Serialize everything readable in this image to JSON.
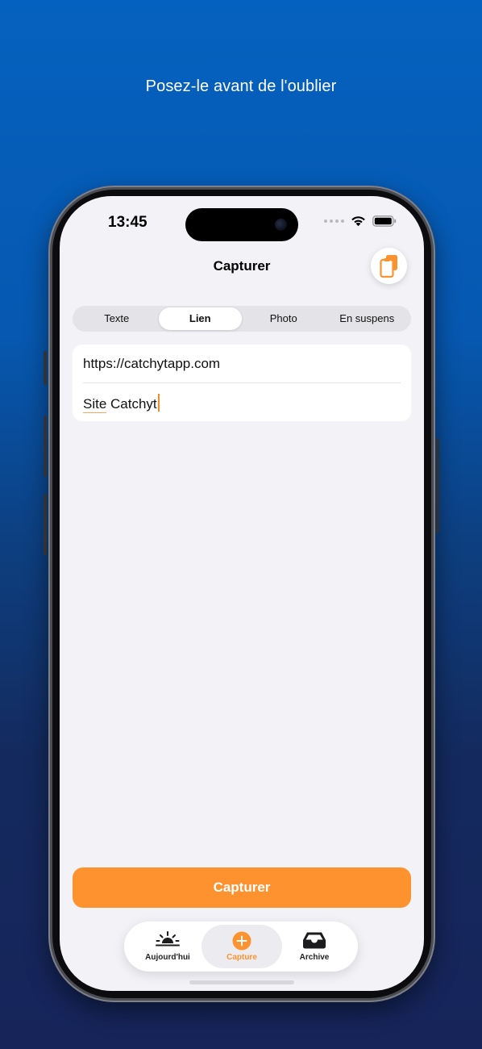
{
  "tagline": "Posez-le avant de l'oublier",
  "status_bar": {
    "time": "13:45"
  },
  "nav": {
    "title": "Capturer",
    "paste_icon": "clipboard-icon"
  },
  "segments": [
    {
      "label": "Texte",
      "active": false
    },
    {
      "label": "Lien",
      "active": true
    },
    {
      "label": "Photo",
      "active": false
    },
    {
      "label": "En suspens",
      "active": false
    }
  ],
  "form": {
    "url_value": "https://catchytapp.com",
    "title_value_underlined": "Site",
    "title_value_rest": " Catchyt"
  },
  "capture_button": {
    "label": "Capturer"
  },
  "tabbar": {
    "items": [
      {
        "label": "Aujourd'hui",
        "icon": "sunrise-icon",
        "active": false
      },
      {
        "label": "Capture",
        "icon": "plus-circle-icon",
        "active": true
      },
      {
        "label": "Archive",
        "icon": "tray-icon",
        "active": false
      }
    ]
  },
  "colors": {
    "accent": "#fd922e",
    "background_top": "#0561bf",
    "background_bottom": "#16245a",
    "screen_bg": "#f2f2f7"
  }
}
